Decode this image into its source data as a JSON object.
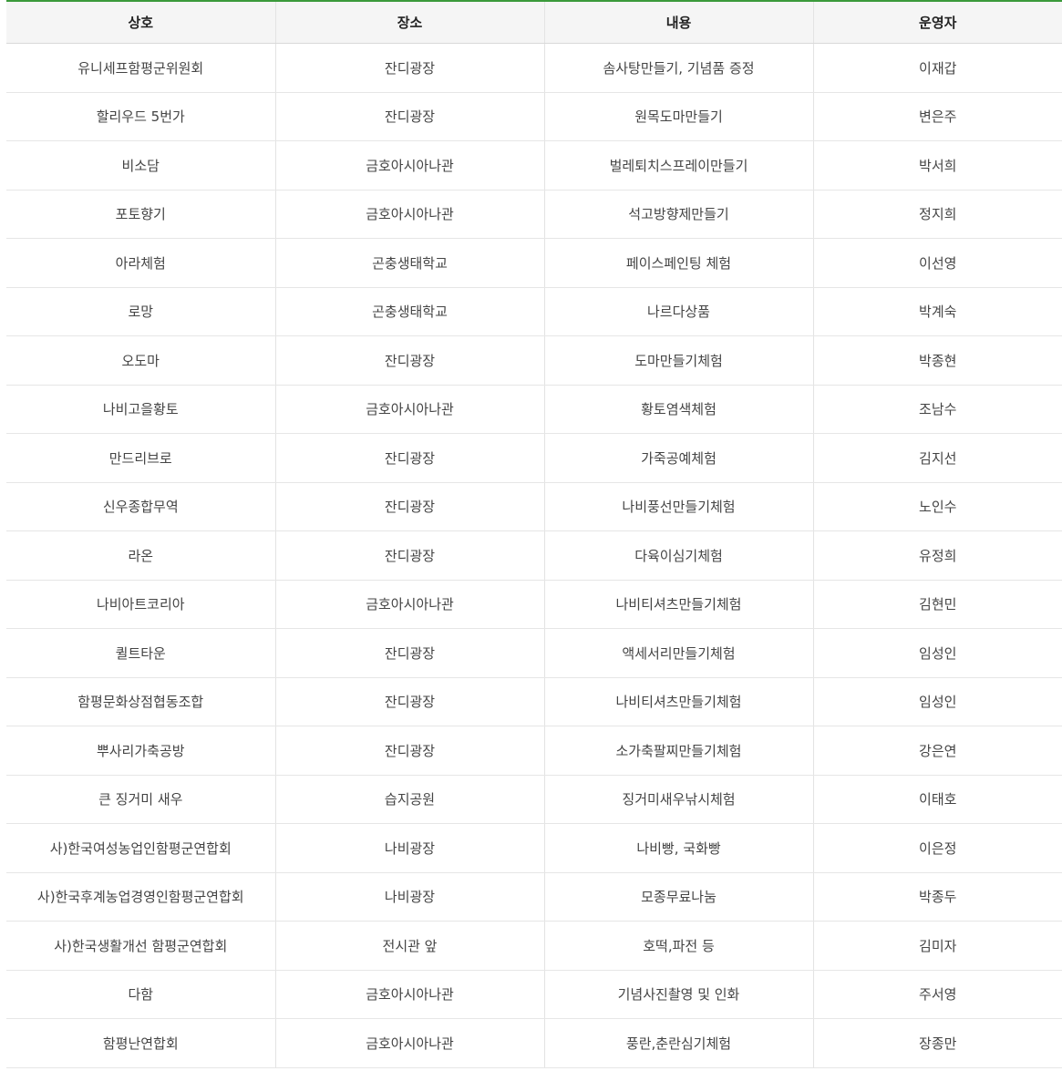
{
  "table": {
    "headers": [
      "상호",
      "장소",
      "내용",
      "운영자"
    ],
    "rows": [
      [
        "유니세프함평군위원회",
        "잔디광장",
        "솜사탕만들기, 기념품 증정",
        "이재갑"
      ],
      [
        "할리우드 5번가",
        "잔디광장",
        "원목도마만들기",
        "변은주"
      ],
      [
        "비소담",
        "금호아시아나관",
        "벌레퇴치스프레이만들기",
        "박서희"
      ],
      [
        "포토향기",
        "금호아시아나관",
        "석고방향제만들기",
        "정지희"
      ],
      [
        "아라체험",
        "곤충생태학교",
        "페이스페인팅 체험",
        "이선영"
      ],
      [
        "로망",
        "곤충생태학교",
        "나르다상품",
        "박계숙"
      ],
      [
        "오도마",
        "잔디광장",
        "도마만들기체험",
        "박종현"
      ],
      [
        "나비고을황토",
        "금호아시아나관",
        "황토염색체험",
        "조남수"
      ],
      [
        "만드리브로",
        "잔디광장",
        "가죽공예체험",
        "김지선"
      ],
      [
        "신우종합무역",
        "잔디광장",
        "나비풍선만들기체험",
        "노인수"
      ],
      [
        "라온",
        "잔디광장",
        "다육이심기체험",
        "유정희"
      ],
      [
        "나비아트코리아",
        "금호아시아나관",
        "나비티셔츠만들기체험",
        "김현민"
      ],
      [
        "퀼트타운",
        "잔디광장",
        "액세서리만들기체험",
        "임성인"
      ],
      [
        "함평문화상점협동조합",
        "잔디광장",
        "나비티셔츠만들기체험",
        "임성인"
      ],
      [
        "뿌사리가축공방",
        "잔디광장",
        "소가축팔찌만들기체험",
        "강은연"
      ],
      [
        "큰 징거미 새우",
        "습지공원",
        "징거미새우낚시체험",
        "이태호"
      ],
      [
        "사)한국여성농업인함평군연합회",
        "나비광장",
        "나비빵, 국화빵",
        "이은정"
      ],
      [
        "사)한국후계농업경영인함평군연합회",
        "나비광장",
        "모종무료나눔",
        "박종두"
      ],
      [
        "사)한국생활개선 함평군연합회",
        "전시관 앞",
        "호떡,파전 등",
        "김미자"
      ],
      [
        "다함",
        "금호아시아나관",
        "기념사진촬영 및 인화",
        "주서영"
      ],
      [
        "함평난연합회",
        "금호아시아나관",
        "풍란,춘란심기체험",
        "장종만"
      ]
    ]
  }
}
